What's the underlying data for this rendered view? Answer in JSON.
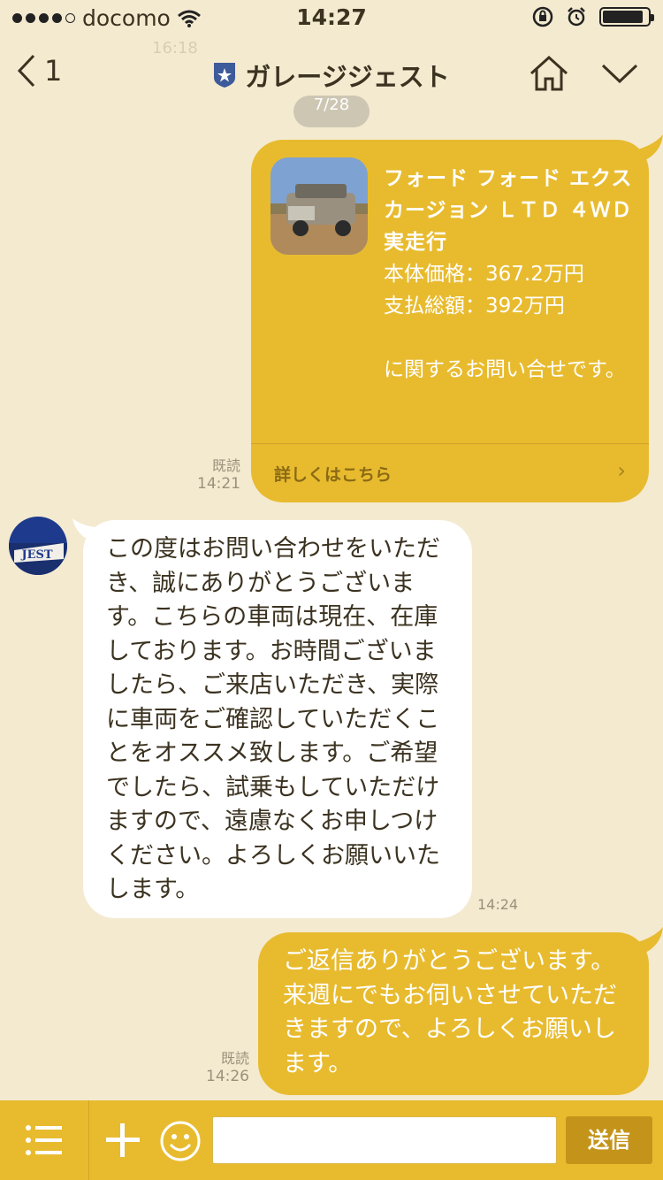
{
  "status_bar": {
    "carrier": "docomo",
    "time": "14:27",
    "signal_bars_filled": 4,
    "signal_bars_total": 5,
    "battery_level": 0.9
  },
  "background_time": "16:18",
  "nav": {
    "back_count": "1",
    "title": "ガレージジェスト",
    "home_icon": "home-icon",
    "chevron_icon": "chevron-down-icon"
  },
  "date_label": "7/28",
  "messages": {
    "inquiry": {
      "title": "フォード フォード エクスカージョン ＬＴＤ ４ＷＤ 実走行",
      "price": "本体価格：367.2万円",
      "total": "支払総額：392万円",
      "note": "に関するお問い合せです。",
      "link": "詳しくはこちら",
      "read": "既読",
      "time": "14:21"
    },
    "reply": {
      "text": "この度はお問い合わせをいただき、誠にありがとうございます。こちらの車両は現在、在庫しております。お時間ございましたら、ご来店いただき、実際に車両をご確認していただくことをオススメ致します。ご希望でしたら、試乗もしていただけますので、遠慮なくお申しつけください。よろしくお願いいたします。",
      "time": "14:24",
      "avatar_text": "JEST"
    },
    "followup": {
      "text": "ご返信ありがとうございます。来週にでもお伺いさせていただきますので、よろしくお願いします。",
      "read": "既読",
      "time": "14:26"
    }
  },
  "input_bar": {
    "placeholder": "",
    "send_label": "送信"
  },
  "colors": {
    "background": "#f4ead0",
    "bubble_out": "#e8bb2f",
    "bubble_in": "#ffffff",
    "bar": "#e8bb2f"
  }
}
